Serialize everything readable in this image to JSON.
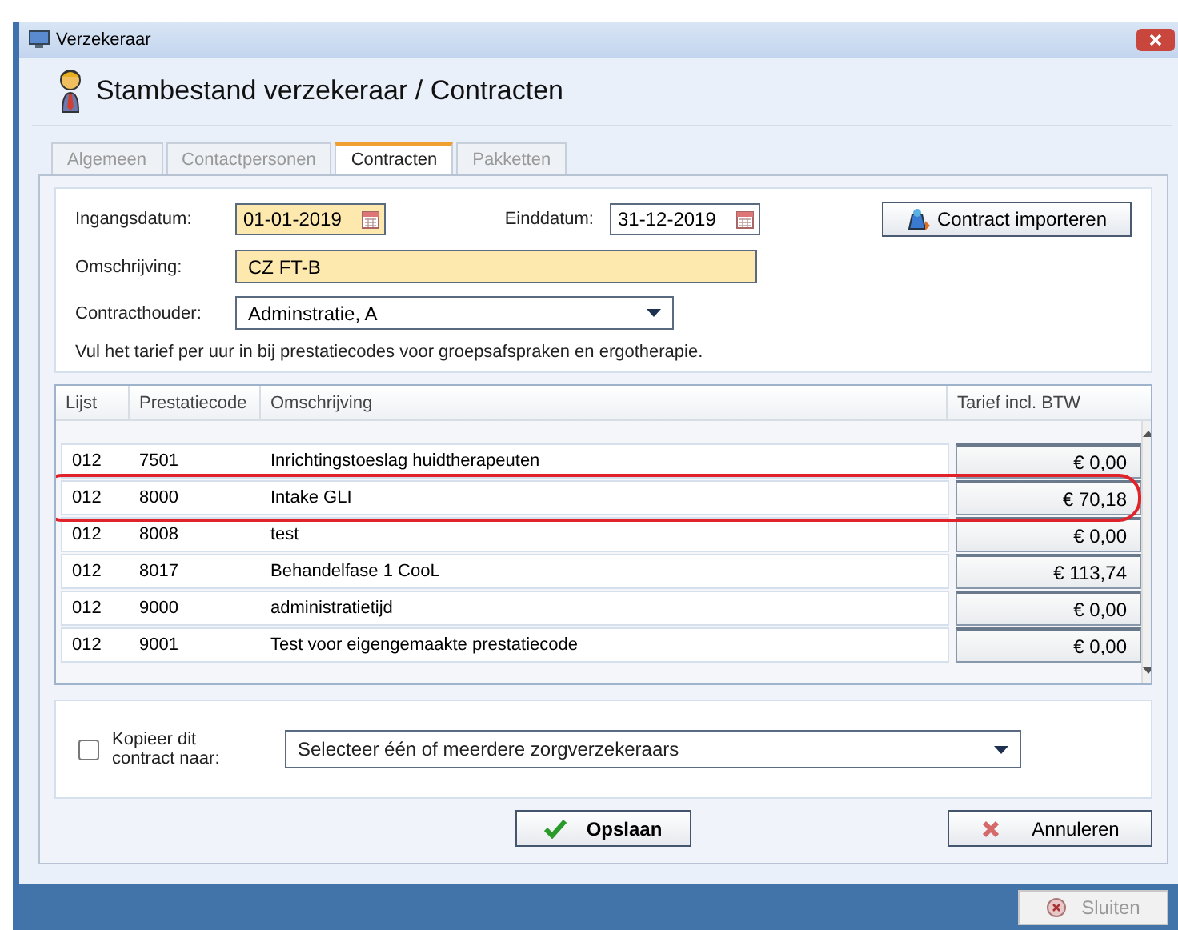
{
  "window": {
    "title": "Verzekeraar"
  },
  "header": {
    "title": "Stambestand verzekeraar / Contracten"
  },
  "tabs": [
    {
      "label": "Algemeen",
      "selected": false
    },
    {
      "label": "Contactpersonen",
      "selected": false
    },
    {
      "label": "Contracten",
      "selected": true
    },
    {
      "label": "Pakketten",
      "selected": false
    }
  ],
  "form": {
    "start_date": {
      "label": "Ingangsdatum:",
      "value": "01-01-2019"
    },
    "end_date": {
      "label": "Einddatum:",
      "value": "31-12-2019"
    },
    "import_button": "Contract importeren",
    "description": {
      "label": "Omschrijving:",
      "value": "CZ FT-B"
    },
    "holder": {
      "label": "Contracthouder:",
      "value": "Adminstratie, A"
    },
    "hint": "Vul het tarief per uur in bij prestatiecodes voor groepsafspraken en ergotherapie."
  },
  "table": {
    "columns": [
      "Lijst",
      "Prestatiecode",
      "Omschrijving",
      "Tarief incl. BTW"
    ],
    "rows": [
      {
        "list": "012",
        "code": "7501",
        "description": "Inrichtingstoeslag huidtherapeuten",
        "rate": "€ 0,00",
        "highlighted": false
      },
      {
        "list": "012",
        "code": "8000",
        "description": "Intake GLI",
        "rate": "€ 70,18",
        "highlighted": true
      },
      {
        "list": "012",
        "code": "8008",
        "description": "test",
        "rate": "€ 0,00",
        "highlighted": false
      },
      {
        "list": "012",
        "code": "8017",
        "description": "Behandelfase 1 CooL",
        "rate": "€ 113,74",
        "highlighted": false
      },
      {
        "list": "012",
        "code": "9000",
        "description": "administratietijd",
        "rate": "€ 0,00",
        "highlighted": false
      },
      {
        "list": "012",
        "code": "9001",
        "description": "Test voor eigengemaakte prestatiecode",
        "rate": "€ 0,00",
        "highlighted": false
      }
    ]
  },
  "copy": {
    "checked": false,
    "label": "Kopieer dit contract naar:",
    "placeholder": "Selecteer één of meerdere zorgverzekeraars"
  },
  "buttons": {
    "save": "Opslaan",
    "cancel": "Annuleren"
  },
  "footer": {
    "close": {
      "label": "Sluiten",
      "disabled": true
    }
  }
}
